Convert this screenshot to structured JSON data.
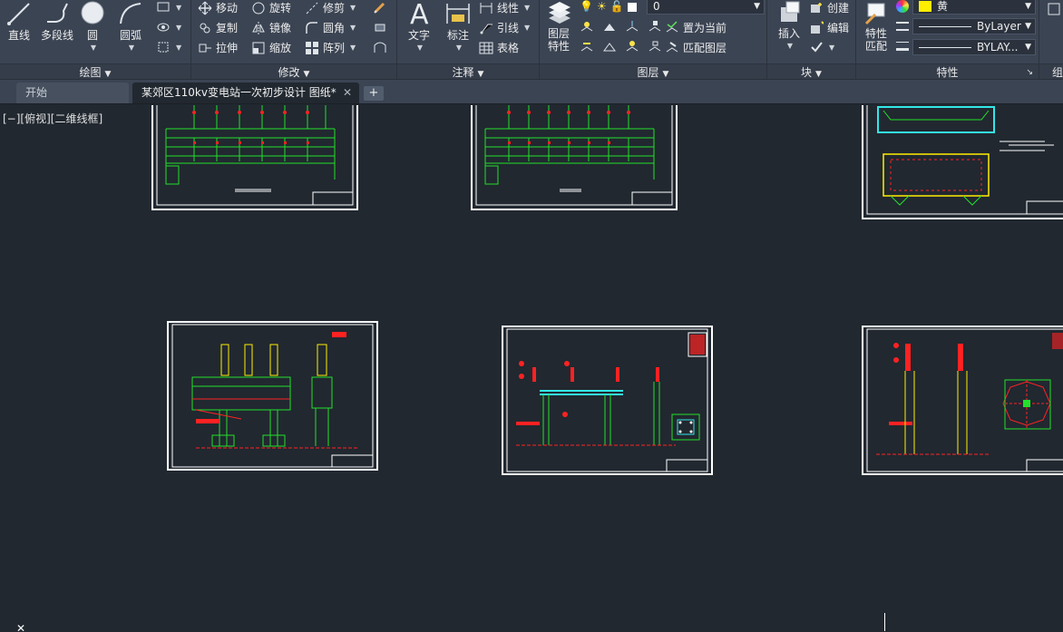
{
  "ribbon": {
    "draw_panel": {
      "title": "绘图",
      "line": "直线",
      "polyline": "多段线",
      "circle": "圆",
      "arc": "圆弧"
    },
    "modify_panel": {
      "title": "修改",
      "move": "移动",
      "rotate": "旋转",
      "trim": "修剪",
      "copy": "复制",
      "mirror": "镜像",
      "fillet": "圆角",
      "stretch": "拉伸",
      "scale": "缩放",
      "array": "阵列"
    },
    "annotation_panel": {
      "title": "注释",
      "text": "文字",
      "dimension": "标注",
      "linear": "线性",
      "leader": "引线",
      "table": "表格"
    },
    "layers_panel": {
      "title": "图层",
      "layer_properties_l1": "图层",
      "layer_properties_l2": "特性",
      "current_layer": "0",
      "set_current": "置为当前",
      "match_layer": "匹配图层"
    },
    "block_panel": {
      "title": "块",
      "insert": "插入",
      "create": "创建",
      "edit": "编辑"
    },
    "properties_panel": {
      "title": "特性",
      "match_l1": "特性",
      "match_l2": "匹配",
      "color": "黄",
      "linetype": "ByLayer",
      "lineweight": "BYLAY..."
    },
    "group_panel": {
      "title": "组"
    }
  },
  "tabs": {
    "start": "开始",
    "drawing": "某郊区110kv变电站一次初步设计 图纸*"
  },
  "canvas": {
    "viewport_label": "[−][俯视][二维线框]"
  },
  "colors": {
    "ribbon_bg": "#3b4453",
    "canvas_bg": "#212830",
    "drawing_green": "#22e02a",
    "drawing_red": "#ff2222",
    "drawing_yellow": "#ffee00",
    "drawing_cyan": "#33e6e6",
    "sheet_border": "#ffffff",
    "layer_color_swatch": "#ffee00"
  }
}
